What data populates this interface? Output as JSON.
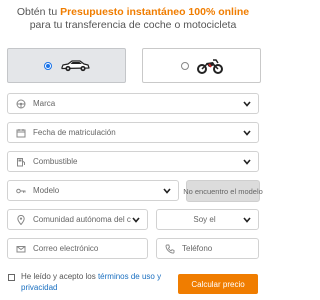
{
  "headline": {
    "prefix": "Obtén tu ",
    "highlight": "Presupuesto instantáneo 100% online",
    "suffix": " para tu transferencia de coche o motocicleta"
  },
  "vehicle_type": {
    "options": [
      {
        "name": "car",
        "icon": "car-icon",
        "selected": true
      },
      {
        "name": "motorcycle",
        "icon": "motorcycle-icon",
        "selected": false
      }
    ]
  },
  "form": {
    "marca": "Marca",
    "fecha": "Fecha de matriculación",
    "combustible": "Combustible",
    "modelo": "Modelo",
    "no_model_button": "No encuentro el modelo",
    "comunidad": "Comunidad autónoma del com",
    "soy_el": "Soy el",
    "correo": "Correo electrónico",
    "telefono": "Teléfono"
  },
  "consent": {
    "prefix": "He leído y acepto los ",
    "link": "términos de uso y privacidad"
  },
  "submit_label": "Calcular precio",
  "colors": {
    "accent": "#f07d00",
    "link": "#1a6fc0",
    "radio": "#1a73e8",
    "selected_card": "#e4e6e9"
  }
}
